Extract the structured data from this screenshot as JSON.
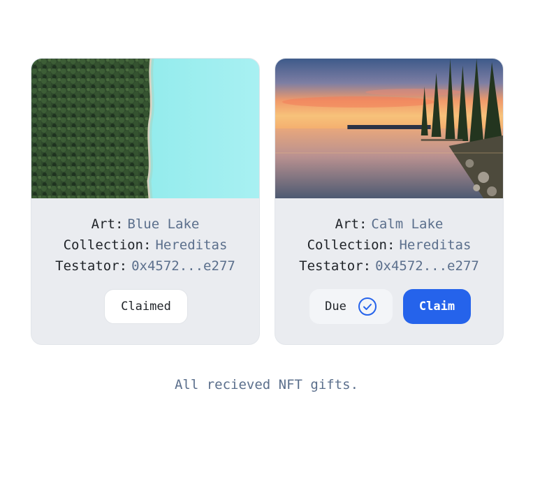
{
  "cards": [
    {
      "image": "aerial view of pine forest beside turquoise lake",
      "art_label": "Art:",
      "art_value": "Blue Lake",
      "collection_label": "Collection:",
      "collection_value": "Hereditas",
      "testator_label": "Testator:",
      "testator_value": "0x4572...e277",
      "status_button": "Claimed"
    },
    {
      "image": "sunset over calm lake with pine trees",
      "art_label": "Art:",
      "art_value": "Calm Lake",
      "collection_label": "Collection:",
      "collection_value": "Hereditas",
      "testator_label": "Testator:",
      "testator_value": "0x4572...e277",
      "status_label": "Due",
      "status_icon": "check-circle-icon",
      "action_button": "Claim"
    }
  ],
  "footer_text": "All recieved NFT gifts.",
  "colors": {
    "accent": "#2563eb",
    "muted": "#5b6f8c",
    "card_bg": "#eaecf0"
  }
}
